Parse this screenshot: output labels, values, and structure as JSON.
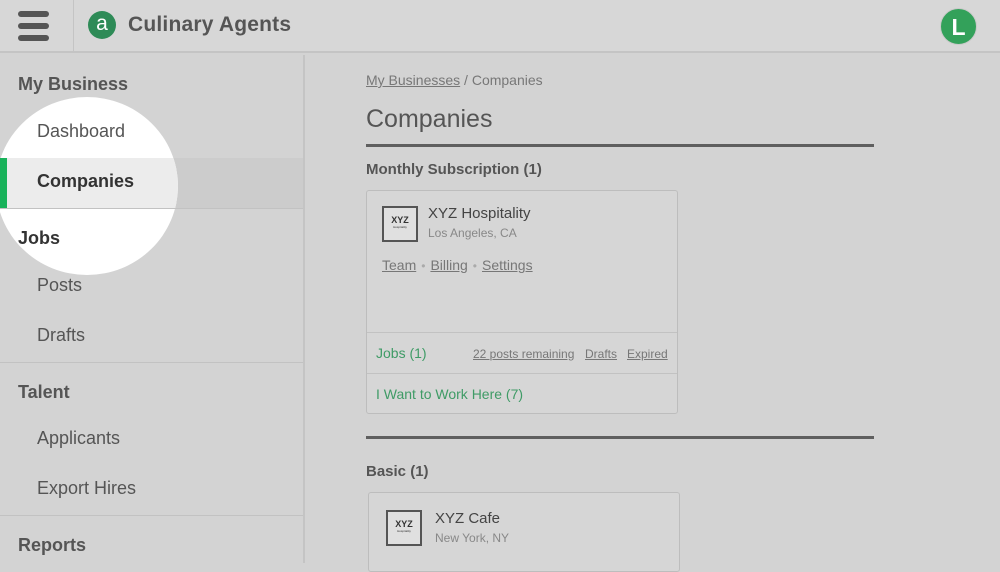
{
  "topbar": {
    "logo_letter": "a",
    "brand_name": "Culinary Agents",
    "avatar_letter": "L"
  },
  "sidebar": {
    "sections": [
      {
        "title": "My Business",
        "items": [
          "Dashboard",
          "Companies"
        ]
      },
      {
        "title": "Jobs",
        "items": [
          "Posts",
          "Drafts"
        ]
      },
      {
        "title": "Talent",
        "items": [
          "Applicants",
          "Export Hires"
        ]
      },
      {
        "title": "Reports",
        "items": []
      }
    ],
    "active_item": "Companies"
  },
  "breadcrumb": {
    "parent": "My Businesses",
    "separator": " / ",
    "current": "Companies"
  },
  "page_title": "Companies",
  "groups": [
    {
      "title": "Monthly Subscription (1)",
      "company": {
        "logo_text": "XYZ",
        "logo_subtext": "Hospitality",
        "name": "XYZ Hospitality",
        "location": "Los Angeles, CA",
        "links": [
          "Team",
          "Billing",
          "Settings"
        ],
        "jobs_label": "Jobs (1)",
        "posts_remaining": "22 posts remaining",
        "drafts": "Drafts",
        "expired": "Expired",
        "work_here": "I Want to Work Here (7)"
      }
    },
    {
      "title": "Basic (1)",
      "company": {
        "logo_text": "XYZ",
        "logo_subtext": "Hospitality",
        "name": "XYZ Cafe",
        "location": "New York, NY"
      }
    }
  ],
  "colors": {
    "accent_green": "#19b25b",
    "link_green": "#3f9b66",
    "logo_green": "#2e8b57"
  }
}
